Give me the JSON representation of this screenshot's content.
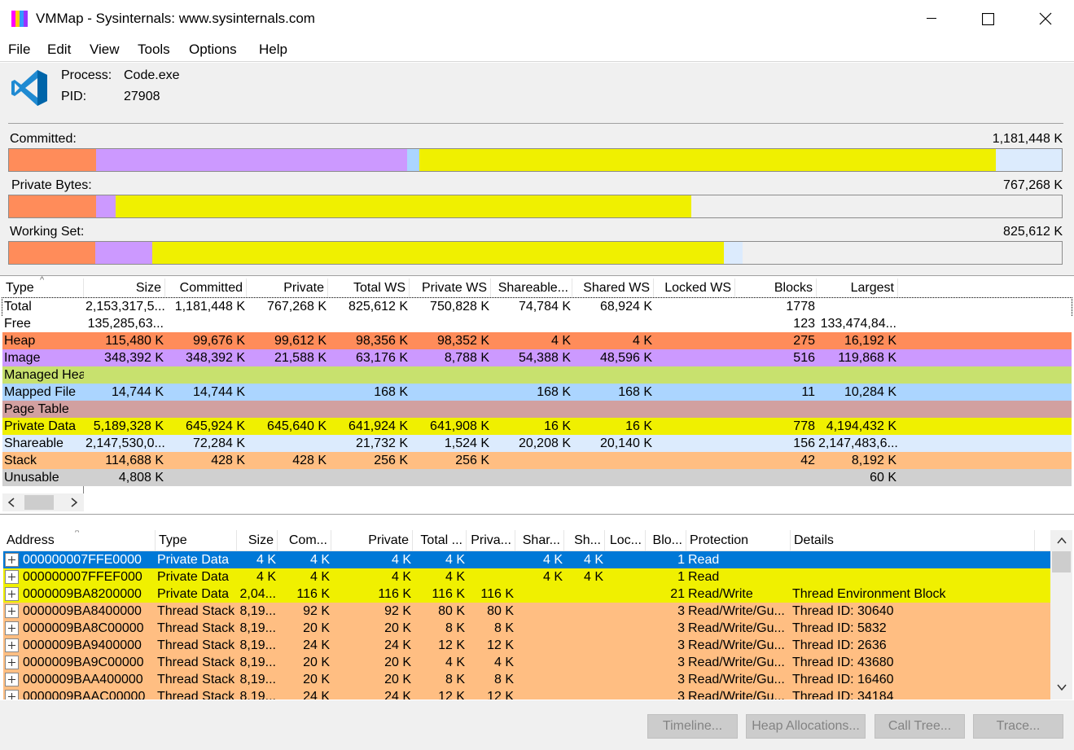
{
  "window": {
    "title": "VMMap - Sysinternals: www.sysinternals.com",
    "icon_colors": [
      "#ff00ff",
      "#ffcc00",
      "#3399ff",
      "#9933ff"
    ]
  },
  "menu": [
    "File",
    "Edit",
    "View",
    "Tools",
    "Options",
    "Help"
  ],
  "process": {
    "process_label": "Process:",
    "process_value": "Code.exe",
    "pid_label": "PID:",
    "pid_value": "27908",
    "icon": "vscode-icon"
  },
  "bars": [
    {
      "label": "Committed:",
      "total": "1,181,448 K",
      "segments": [
        {
          "color": "#ff8c5a",
          "fraction": 0.083
        },
        {
          "color": "#cc99ff",
          "fraction": 0.295
        },
        {
          "color": "#abd5ff",
          "fraction": 0.012
        },
        {
          "color": "#f0f000",
          "fraction": 0.547
        },
        {
          "color": "#dcebfd",
          "fraction": 0.063
        }
      ]
    },
    {
      "label": "Private Bytes:",
      "total": "767,268 K",
      "segments": [
        {
          "color": "#ff8c5a",
          "fraction": 0.083
        },
        {
          "color": "#cc99ff",
          "fraction": 0.018
        },
        {
          "color": "#f0f000",
          "fraction": 0.547
        }
      ]
    },
    {
      "label": "Working Set:",
      "total": "825,612 K",
      "segments": [
        {
          "color": "#ff8c5a",
          "fraction": 0.082
        },
        {
          "color": "#cc99ff",
          "fraction": 0.054
        },
        {
          "color": "#f0f000",
          "fraction": 0.543
        },
        {
          "color": "#dcebfd",
          "fraction": 0.018
        }
      ]
    }
  ],
  "summary": {
    "columns": [
      "Type",
      "Size",
      "Committed",
      "Private",
      "Total WS",
      "Private WS",
      "Shareable...",
      "Shared WS",
      "Locked WS",
      "Blocks",
      "Largest"
    ],
    "rows": [
      {
        "cells": [
          "Total",
          "2,153,317,5...",
          "1,181,448 K",
          "767,268 K",
          "825,612 K",
          "750,828 K",
          "74,784 K",
          "68,924 K",
          "",
          "1778",
          ""
        ],
        "color": "#ffffff"
      },
      {
        "cells": [
          "Free",
          "135,285,63...",
          "",
          "",
          "",
          "",
          "",
          "",
          "",
          "123",
          "133,474,84..."
        ],
        "color": "#ffffff"
      },
      {
        "cells": [
          "Heap",
          "115,480 K",
          "99,676 K",
          "99,612 K",
          "98,356 K",
          "98,352 K",
          "4 K",
          "4 K",
          "",
          "275",
          "16,192 K"
        ],
        "color": "#ff8c5a"
      },
      {
        "cells": [
          "Image",
          "348,392 K",
          "348,392 K",
          "21,588 K",
          "63,176 K",
          "8,788 K",
          "54,388 K",
          "48,596 K",
          "",
          "516",
          "119,868 K"
        ],
        "color": "#cc99ff"
      },
      {
        "cells": [
          "Managed Hea",
          "",
          "",
          "",
          "",
          "",
          "",
          "",
          "",
          "",
          ""
        ],
        "color": "#c8e16e"
      },
      {
        "cells": [
          "Mapped File",
          "14,744 K",
          "14,744 K",
          "",
          "168 K",
          "",
          "168 K",
          "168 K",
          "",
          "11",
          "10,284 K"
        ],
        "color": "#abd5ff"
      },
      {
        "cells": [
          "Page Table",
          "",
          "",
          "",
          "",
          "",
          "",
          "",
          "",
          "",
          ""
        ],
        "color": "#d2a0a0"
      },
      {
        "cells": [
          "Private Data",
          "5,189,328 K",
          "645,924 K",
          "645,640 K",
          "641,924 K",
          "641,908 K",
          "16 K",
          "16 K",
          "",
          "778",
          "4,194,432 K"
        ],
        "color": "#f0f000"
      },
      {
        "cells": [
          "Shareable",
          "2,147,530,0...",
          "72,284 K",
          "",
          "21,732 K",
          "1,524 K",
          "20,208 K",
          "20,140 K",
          "",
          "156",
          "2,147,483,6..."
        ],
        "color": "#dcebfd"
      },
      {
        "cells": [
          "Stack",
          "114,688 K",
          "428 K",
          "428 K",
          "256 K",
          "256 K",
          "",
          "",
          "",
          "42",
          "8,192 K"
        ],
        "color": "#ffbe82"
      },
      {
        "cells": [
          "Unusable",
          "4,808 K",
          "",
          "",
          "",
          "",
          "",
          "",
          "",
          "",
          "60 K"
        ],
        "color": "#d0d0d0"
      }
    ]
  },
  "detail": {
    "columns": [
      "Address",
      "Type",
      "Size",
      "Com...",
      "Private",
      "Total ...",
      "Priva...",
      "Shar...",
      "Sh...",
      "Loc...",
      "Blo...",
      "Protection",
      "Details"
    ],
    "rows": [
      {
        "cells": [
          "000000007FFE0000",
          "Private Data",
          "4 K",
          "4 K",
          "4 K",
          "4 K",
          "",
          "4 K",
          "4 K",
          "",
          "1",
          "Read",
          ""
        ],
        "color": "#0078d7",
        "selected": true
      },
      {
        "cells": [
          "000000007FFEF000",
          "Private Data",
          "4 K",
          "4 K",
          "4 K",
          "4 K",
          "",
          "4 K",
          "4 K",
          "",
          "1",
          "Read",
          ""
        ],
        "color": "#f0f000"
      },
      {
        "cells": [
          "0000009BA8200000",
          "Private Data",
          "2,04...",
          "116 K",
          "116 K",
          "116 K",
          "116 K",
          "",
          "",
          "",
          "21",
          "Read/Write",
          "Thread Environment Block"
        ],
        "color": "#f0f000"
      },
      {
        "cells": [
          "0000009BA8400000",
          "Thread Stack",
          "8,19...",
          "92 K",
          "92 K",
          "80 K",
          "80 K",
          "",
          "",
          "",
          "3",
          "Read/Write/Gu...",
          "Thread ID: 30640"
        ],
        "color": "#ffbe82"
      },
      {
        "cells": [
          "0000009BA8C00000",
          "Thread Stack",
          "8,19...",
          "20 K",
          "20 K",
          "8 K",
          "8 K",
          "",
          "",
          "",
          "3",
          "Read/Write/Gu...",
          "Thread ID: 5832"
        ],
        "color": "#ffbe82"
      },
      {
        "cells": [
          "0000009BA9400000",
          "Thread Stack",
          "8,19...",
          "24 K",
          "24 K",
          "12 K",
          "12 K",
          "",
          "",
          "",
          "3",
          "Read/Write/Gu...",
          "Thread ID: 2636"
        ],
        "color": "#ffbe82"
      },
      {
        "cells": [
          "0000009BA9C00000",
          "Thread Stack",
          "8,19...",
          "20 K",
          "20 K",
          "4 K",
          "4 K",
          "",
          "",
          "",
          "3",
          "Read/Write/Gu...",
          "Thread ID: 43680"
        ],
        "color": "#ffbe82"
      },
      {
        "cells": [
          "0000009BAA400000",
          "Thread Stack",
          "8,19...",
          "20 K",
          "20 K",
          "8 K",
          "8 K",
          "",
          "",
          "",
          "3",
          "Read/Write/Gu...",
          "Thread ID: 16460"
        ],
        "color": "#ffbe82"
      },
      {
        "cells": [
          "0000009BAAC00000",
          "Thread Stack",
          "8,19...",
          "24 K",
          "24 K",
          "12 K",
          "12 K",
          "",
          "",
          "",
          "3",
          "Read/Write/Gu...",
          "Thread ID: 34184"
        ],
        "color": "#ffbe82"
      }
    ]
  },
  "buttons": [
    "Timeline...",
    "Heap Allocations...",
    "Call Tree...",
    "Trace..."
  ]
}
